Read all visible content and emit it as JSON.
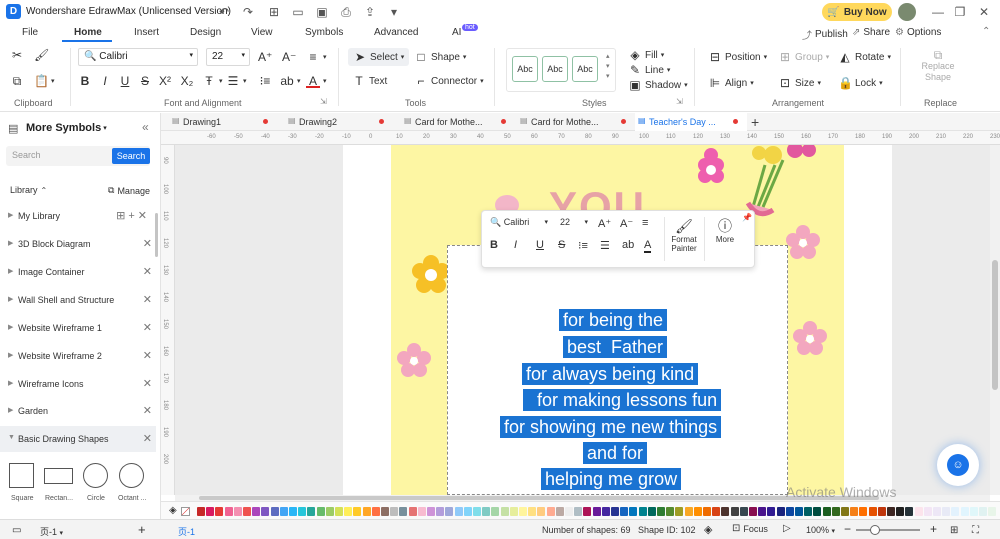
{
  "app": {
    "title": "Wondershare EdrawMax (Unlicensed Version)",
    "buy_now": "Buy Now",
    "watermark": "Activate Windows"
  },
  "menu": {
    "tabs": [
      "File",
      "Home",
      "Insert",
      "Design",
      "View",
      "Symbols",
      "Advanced",
      "AI"
    ],
    "ai_badge": "hot",
    "publish": "Publish",
    "share": "Share",
    "options": "Options"
  },
  "ribbon": {
    "clipboard": {
      "label": "Clipboard"
    },
    "font": {
      "label": "Font and Alignment",
      "family": "Calibri",
      "size": "22"
    },
    "tools": {
      "label": "Tools",
      "select": "Select",
      "shape": "Shape",
      "text": "Text",
      "connector": "Connector"
    },
    "styles": {
      "label": "Styles",
      "abc": "Abc",
      "fill": "Fill",
      "line": "Line",
      "shadow": "Shadow"
    },
    "arrangement": {
      "label": "Arrangement",
      "position": "Position",
      "group": "Group",
      "rotate": "Rotate",
      "align": "Align",
      "size": "Size",
      "lock": "Lock"
    },
    "replace": {
      "label": "Replace",
      "btn": "Replace Shape"
    }
  },
  "left_panel": {
    "title": "More Symbols",
    "search_placeholder": "Search",
    "search_btn": "Search",
    "library": "Library",
    "manage": "Manage",
    "items": [
      "My Library",
      "3D Block Diagram",
      "Image Container",
      "Wall Shell and Structure",
      "Website Wireframe 1",
      "Website Wireframe 2",
      "Wireframe Icons",
      "Garden",
      "Basic Drawing Shapes"
    ],
    "shapes": [
      "Square",
      "Rectan...",
      "Circle",
      "Octant ..."
    ]
  },
  "doc_tabs": [
    "Drawing1",
    "Drawing2",
    "Card for Mothe...",
    "Card for Mothe...",
    "Teacher's Day ..."
  ],
  "ruler": {
    "h": [
      "-60",
      "-50",
      "-40",
      "-30",
      "-20",
      "-10",
      "0",
      "10",
      "20",
      "30",
      "40",
      "50",
      "60",
      "70",
      "80",
      "90",
      "100",
      "110",
      "120",
      "130",
      "140",
      "150",
      "160",
      "170",
      "180",
      "190",
      "200",
      "210",
      "220",
      "230",
      "240"
    ],
    "v": [
      "90",
      "100",
      "110",
      "120",
      "130",
      "140",
      "150",
      "160",
      "170",
      "180",
      "190",
      "200"
    ]
  },
  "card": {
    "lines": [
      "for being the",
      "best  Father",
      "for always being kind",
      "  for making lessons fun",
      "for showing me new things",
      "and for",
      "helping me grow"
    ],
    "heading_partial": "YOU"
  },
  "float_bar": {
    "font": "Calibri",
    "size": "22",
    "format_painter": "Format Painter",
    "more": "More"
  },
  "status": {
    "page": "页-1",
    "page_tab": "页-1",
    "shapes": "Number of shapes: 69",
    "shape_id": "Shape ID: 102",
    "focus": "Focus",
    "zoom": "100%"
  },
  "colors": {
    "accent": "#1a73e8",
    "selection": "#1a73d2",
    "card": "#fdf6a3"
  }
}
